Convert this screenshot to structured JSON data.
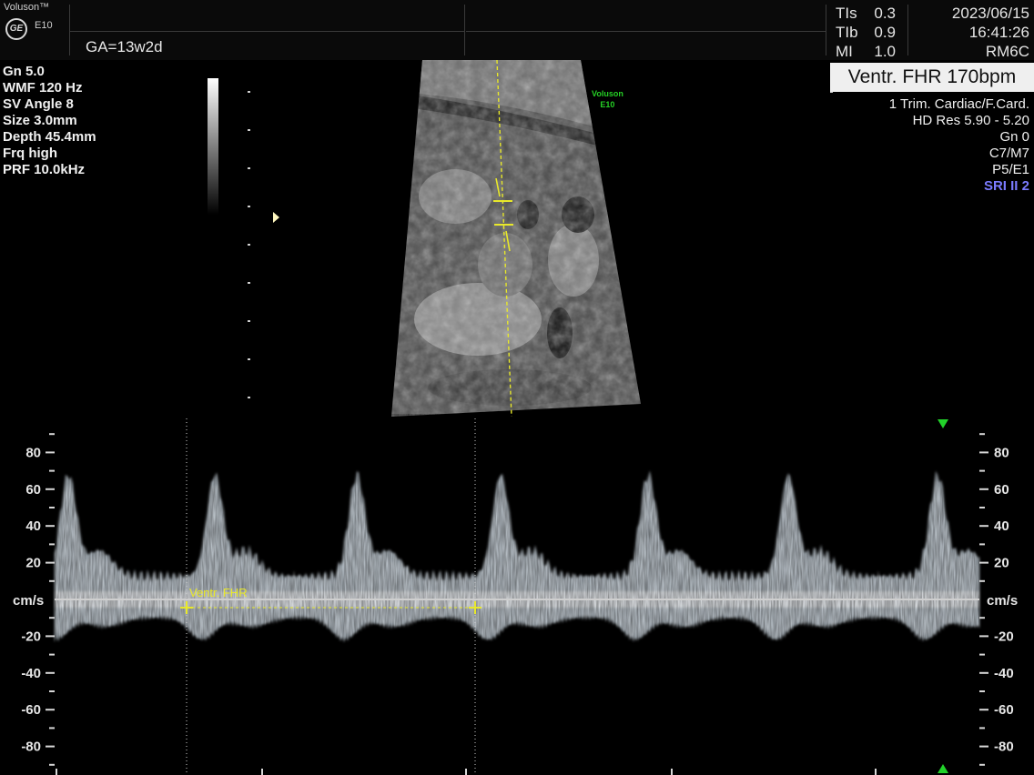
{
  "header": {
    "brand": "Voluson™",
    "logo_text": "GE",
    "model_small": "E10",
    "ga": "GA=13w2d",
    "tis_label": "TIs",
    "tis_value": "0.3",
    "tib_label": "TIb",
    "tib_value": "0.9",
    "mi_label": "MI",
    "mi_value": "1.0",
    "date": "2023/06/15",
    "time": "16:41:26",
    "probe": "RM6C"
  },
  "left_params": [
    "Gn  5.0",
    "WMF 120 Hz",
    "SV Angle  8",
    "Size  3.0mm",
    "Depth 45.4mm",
    "Frq high",
    "PRF 10.0kHz"
  ],
  "right_params": [
    "1 Trim. Cardiac/F.Card.",
    "HD Res 5.90 - 5.20",
    "Gn   0",
    "C7/M7",
    "P5/E1"
  ],
  "sri": "SRI II 2",
  "fhr_badge": "Ventr. FHR 170bpm",
  "watermark": {
    "line1": "Voluson",
    "line2": "E10"
  },
  "doppler": {
    "unit": "cm/s",
    "scale_ticks": [
      "80",
      "60",
      "40",
      "20",
      "-20",
      "-40",
      "-60",
      "-80"
    ],
    "measure_label": "Ventr. FHR"
  },
  "colors": {
    "measure": "#e8e82a",
    "marker": "#22d22a",
    "sri": "#7b7bff",
    "spectrum": "#d8e4ee"
  }
}
